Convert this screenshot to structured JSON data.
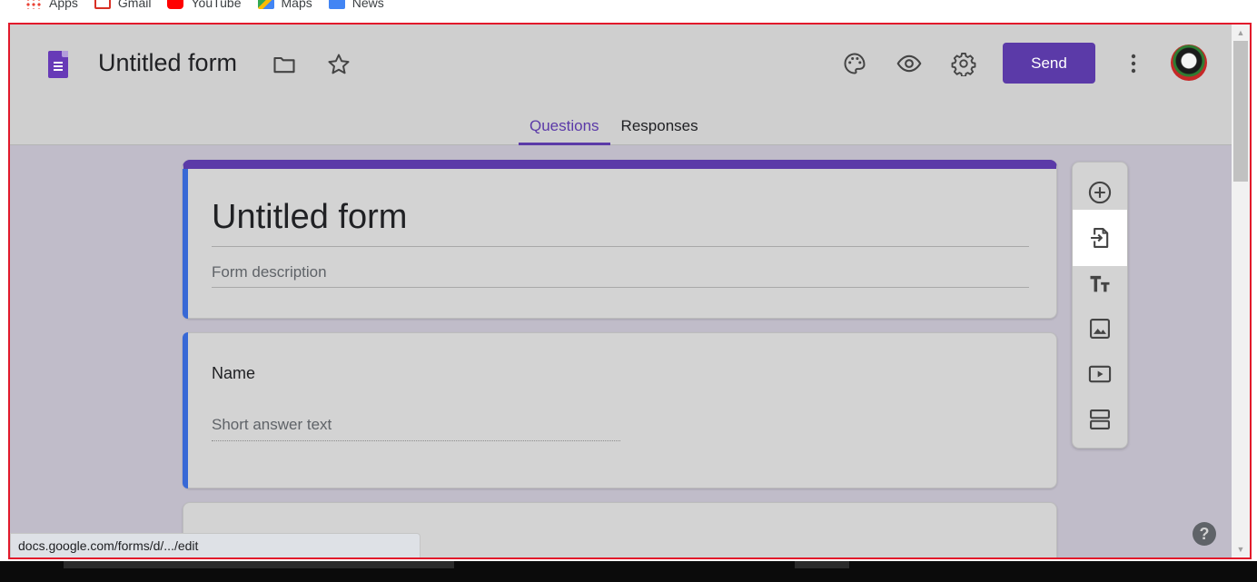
{
  "bookmarks": [
    {
      "label": "Apps",
      "icon": "apps-grid-icon"
    },
    {
      "label": "Gmail",
      "icon": "gmail-icon"
    },
    {
      "label": "YouTube",
      "icon": "youtube-icon"
    },
    {
      "label": "Maps",
      "icon": "maps-icon"
    },
    {
      "label": "News",
      "icon": "news-icon"
    }
  ],
  "header": {
    "doc_title": "Untitled form",
    "send_label": "Send",
    "icons": [
      "folder-icon",
      "star-icon",
      "palette-icon",
      "preview-eye-icon",
      "settings-gear-icon",
      "more-vert-icon"
    ]
  },
  "tabs": [
    {
      "label": "Questions",
      "active": true
    },
    {
      "label": "Responses",
      "active": false
    }
  ],
  "form": {
    "title": "Untitled form",
    "description_placeholder": "Form description"
  },
  "question": {
    "title": "Name",
    "answer_placeholder": "Short answer text"
  },
  "toolbar": {
    "tools": [
      "add-question-icon",
      "import-questions-icon",
      "add-title-icon",
      "add-image-icon",
      "add-video-icon",
      "add-section-icon"
    ]
  },
  "status_url": "docs.google.com/forms/d/.../edit",
  "colors": {
    "accent": "#5b3aa8",
    "focus_blue": "#3868d6",
    "annotation_red": "#e2192b"
  }
}
